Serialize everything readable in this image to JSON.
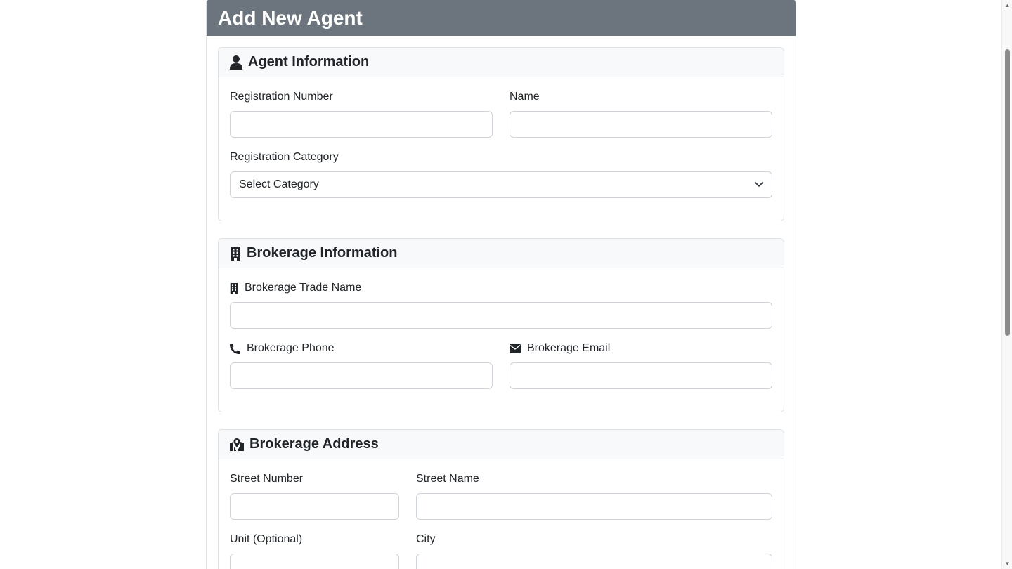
{
  "page": {
    "title": "Add New Agent"
  },
  "agent_section": {
    "title": "Agent Information",
    "icon": "person-icon",
    "registration_number": {
      "label": "Registration Number",
      "value": ""
    },
    "name": {
      "label": "Name",
      "value": ""
    },
    "registration_category": {
      "label": "Registration Category",
      "selected": "Select Category"
    }
  },
  "brokerage_section": {
    "title": "Brokerage Information",
    "icon": "building-icon",
    "trade_name": {
      "label": "Brokerage Trade Name",
      "value": ""
    },
    "phone": {
      "label": "Brokerage Phone",
      "value": ""
    },
    "email": {
      "label": "Brokerage Email",
      "value": ""
    }
  },
  "address_section": {
    "title": "Brokerage Address",
    "icon": "map-location-icon",
    "street_number": {
      "label": "Street Number",
      "value": ""
    },
    "street_name": {
      "label": "Street Name",
      "value": ""
    },
    "unit": {
      "label": "Unit (Optional)",
      "value": ""
    },
    "city": {
      "label": "City",
      "value": ""
    }
  },
  "colors": {
    "header_bg": "#6c757d",
    "section_header_bg": "#f8f9fa",
    "border": "#dee2e6",
    "input_border": "#ced4da"
  }
}
